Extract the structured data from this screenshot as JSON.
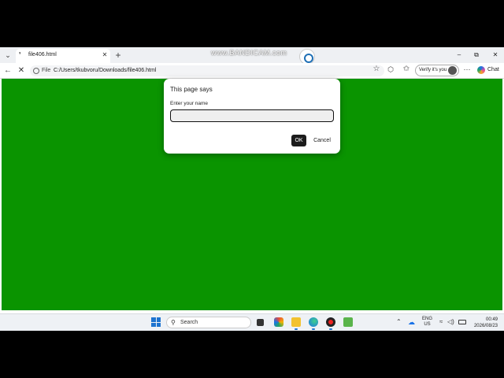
{
  "window": {
    "tab_title": "file406.html",
    "recorder_text": "www.BANDICAM.com",
    "controls": {
      "minimize": "–",
      "maximize": "⧉",
      "close": "✕"
    }
  },
  "toolbar": {
    "address_scheme": "File",
    "address_url": "C:/Users/tkubvoru/Downloads/file406.html",
    "verify_label": "Verify it's you",
    "chat_label": "Chat"
  },
  "page": {
    "background_color": "#0a9400"
  },
  "dialog": {
    "title": "This page says",
    "prompt": "Enter your name",
    "input_value": "",
    "ok_label": "OK",
    "cancel_label": "Cancel"
  },
  "taskbar": {
    "search_label": "Search",
    "lang_line1": "ENG",
    "lang_line2": "US",
    "time": "00:49",
    "date": "2026/08/23"
  }
}
